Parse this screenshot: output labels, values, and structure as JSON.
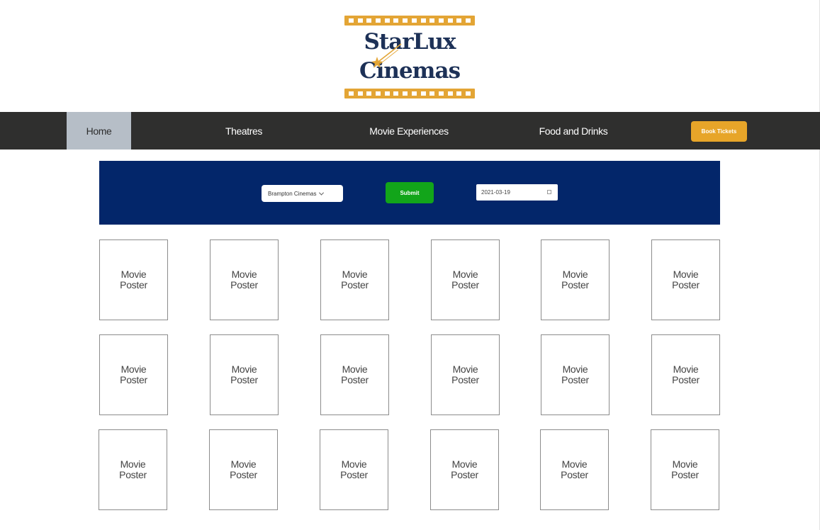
{
  "logo": {
    "line1": "StarLux",
    "line2": "Cinemas",
    "strip_color": "#e3a535",
    "text_color": "#1d3157"
  },
  "nav": {
    "items": [
      {
        "label": "Home",
        "active": true
      },
      {
        "label": "Theatres",
        "active": false
      },
      {
        "label": "Movie Experiences",
        "active": false
      },
      {
        "label": "Food and Drinks",
        "active": false
      }
    ],
    "book_label": "Book Tickets",
    "bar_color": "#2f2f2e",
    "book_color": "#e7a529"
  },
  "filter": {
    "theatre_value": "Brampton Cinemas",
    "submit_label": "Submit",
    "date_value": "2021-03-19",
    "bar_color": "#03266a",
    "submit_color": "#12a51a"
  },
  "posters": [
    {
      "line1": "Movie",
      "line2": "Poster"
    },
    {
      "line1": "Movie",
      "line2": "Poster"
    },
    {
      "line1": "Movie",
      "line2": "Poster"
    },
    {
      "line1": "Movie",
      "line2": "Poster"
    },
    {
      "line1": "Movie",
      "line2": "Poster"
    },
    {
      "line1": "Movie",
      "line2": "Poster"
    },
    {
      "line1": "Movie",
      "line2": "Poster"
    },
    {
      "line1": "Movie",
      "line2": "Poster"
    },
    {
      "line1": "Movie",
      "line2": "Poster"
    },
    {
      "line1": "Movie",
      "line2": "Poster"
    },
    {
      "line1": "Movie",
      "line2": "Poster"
    },
    {
      "line1": "Movie",
      "line2": "Poster"
    },
    {
      "line1": "Movie",
      "line2": "Poster"
    },
    {
      "line1": "Movie",
      "line2": "Poster"
    },
    {
      "line1": "Movie",
      "line2": "Poster"
    },
    {
      "line1": "Movie",
      "line2": "Poster"
    },
    {
      "line1": "Movie",
      "line2": "Poster"
    },
    {
      "line1": "Movie",
      "line2": "Poster"
    }
  ]
}
